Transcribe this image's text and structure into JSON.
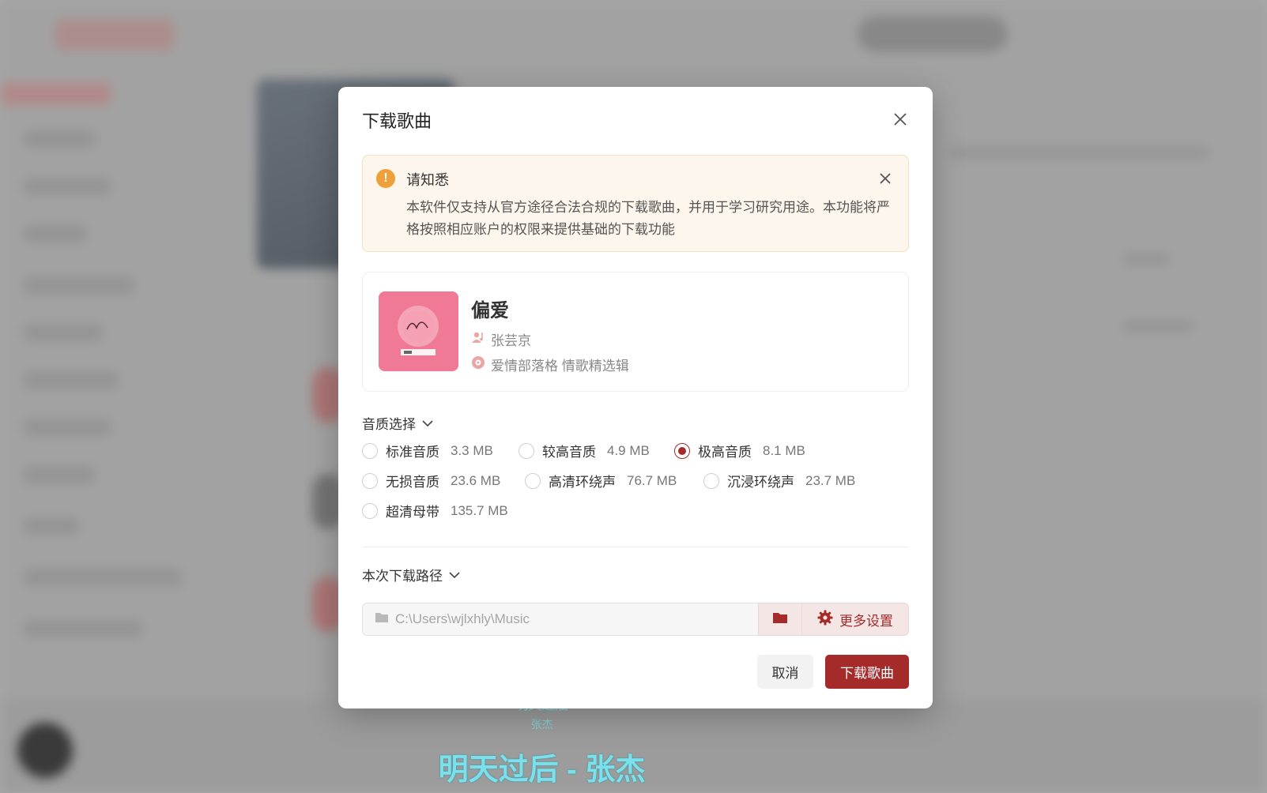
{
  "dialog": {
    "title": "下载歌曲",
    "notice": {
      "title": "请知悉",
      "text": "本软件仅支持从官方途径合法合规的下载歌曲，并用于学习研究用途。本功能将严格按照相应账户的权限来提供基础的下载功能"
    },
    "song": {
      "title": "偏爱",
      "artist": "张芸京",
      "album": "爱情部落格 情歌精选辑"
    },
    "quality": {
      "label": "音质选择",
      "options": [
        {
          "label": "标准音质",
          "size": "3.3 MB",
          "selected": false
        },
        {
          "label": "较高音质",
          "size": "4.9 MB",
          "selected": false
        },
        {
          "label": "极高音质",
          "size": "8.1 MB",
          "selected": true
        },
        {
          "label": "无损音质",
          "size": "23.6 MB",
          "selected": false
        },
        {
          "label": "高清环绕声",
          "size": "76.7 MB",
          "selected": false
        },
        {
          "label": "沉浸环绕声",
          "size": "23.7 MB",
          "selected": false
        },
        {
          "label": "超清母带",
          "size": "135.7 MB",
          "selected": false
        }
      ]
    },
    "path": {
      "label": "本次下载路径",
      "value": "C:\\Users\\wjlxhly\\Music",
      "more_settings": "更多设置"
    },
    "buttons": {
      "cancel": "取消",
      "download": "下载歌曲"
    }
  },
  "lyrics": {
    "small_title": "明天过后",
    "small_artist": "张杰",
    "current": "明天过后 - 张杰"
  },
  "colors": {
    "accent": "#a52b2b",
    "notice_bg": "#fdf6ec",
    "notice_icon": "#eea03a",
    "lyric": "#7ae0ec"
  }
}
